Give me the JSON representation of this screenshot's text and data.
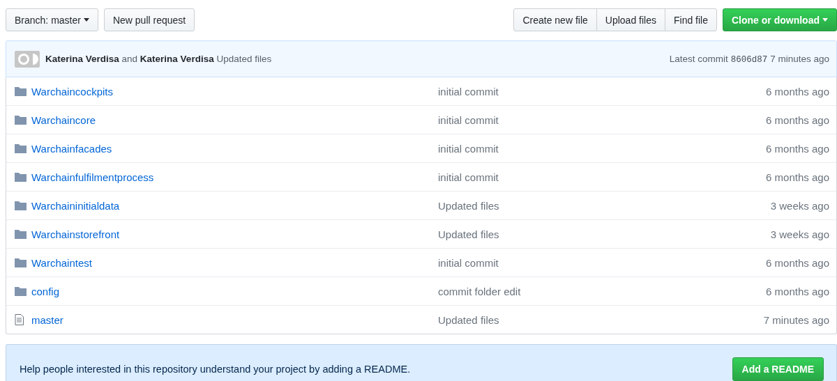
{
  "toolbar": {
    "branch_button": "Branch: master",
    "pull_request_button": "New pull request",
    "file_buttons": [
      "Create new file",
      "Upload files",
      "Find file"
    ],
    "clone_button": "Clone or download"
  },
  "commit_bar": {
    "message": "**Katerina Verdisa** and **Katerina Verdisa** Updated files",
    "latest_label": "Latest commit",
    "sha": "8606d87",
    "age": "7 minutes ago"
  },
  "files": [
    {
      "kind": "folder",
      "name": "Warchaincockpits",
      "message": "initial commit",
      "age": "6 months ago"
    },
    {
      "kind": "folder",
      "name": "Warchaincore",
      "message": "initial commit",
      "age": "6 months ago"
    },
    {
      "kind": "folder",
      "name": "Warchainfacades",
      "message": "initial commit",
      "age": "6 months ago"
    },
    {
      "kind": "folder",
      "name": "Warchainfulfilmentprocess",
      "message": "initial commit",
      "age": "6 months ago"
    },
    {
      "kind": "folder",
      "name": "Warchaininitialdata",
      "message": "Updated files",
      "age": "3 weeks ago"
    },
    {
      "kind": "folder",
      "name": "Warchainstorefront",
      "message": "Updated files",
      "age": "3 weeks ago"
    },
    {
      "kind": "folder",
      "name": "Warchaintest",
      "message": "initial commit",
      "age": "6 months ago"
    },
    {
      "kind": "folder",
      "name": "config",
      "message": "commit folder edit",
      "age": "6 months ago"
    },
    {
      "kind": "file",
      "name": "master",
      "message": "Updated files",
      "age": "7 minutes ago"
    }
  ],
  "readme_banner": {
    "text": "Help people interested in this repository understand your project by adding a README.",
    "button": "Add a README"
  }
}
